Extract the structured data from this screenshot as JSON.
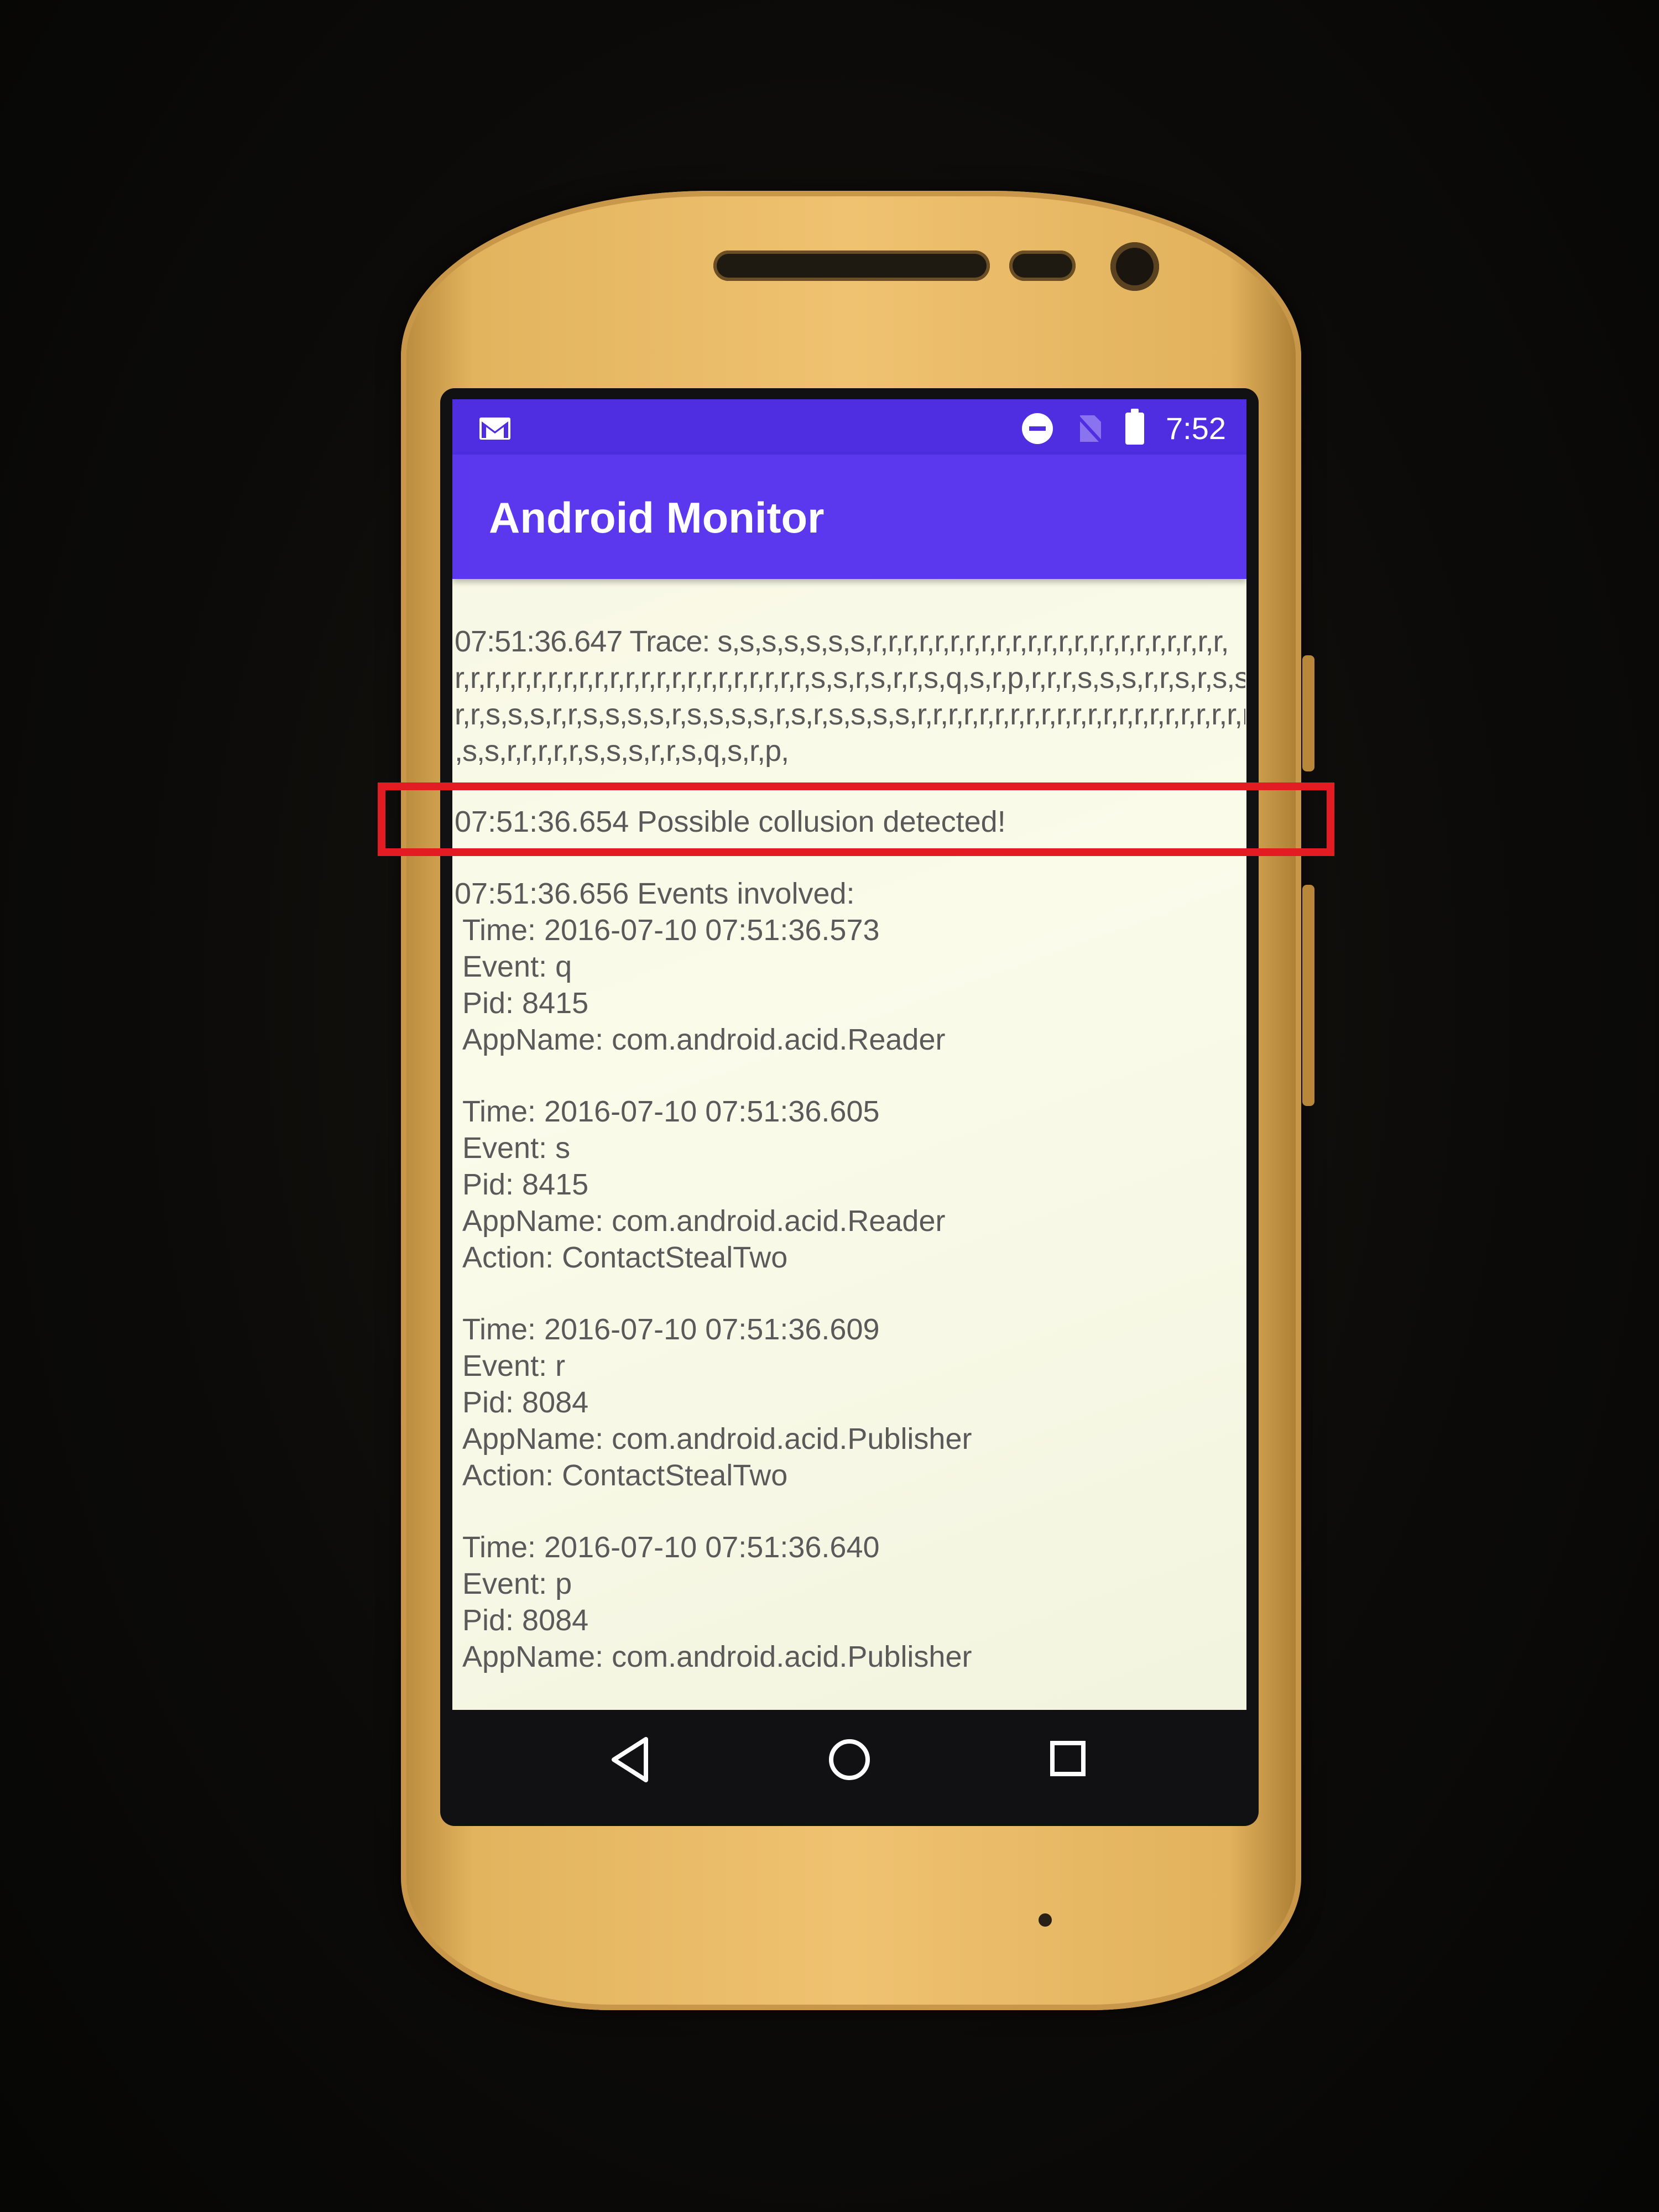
{
  "status_bar": {
    "time": "7:52",
    "icons": [
      "gmail-icon",
      "do-not-disturb-icon",
      "no-sim-icon",
      "battery-icon"
    ]
  },
  "app_bar": {
    "title": "Android Monitor"
  },
  "log": {
    "trace_lines": [
      "07:51:36.647 Trace: s,s,s,s,s,s,s,r,r,r,r,r,r,r,r,r,r,r,r,r,r,r,r,r,r,r,r,r,r,r,",
      "r,r,r,r,r,r,r,r,r,r,r,r,r,r,r,r,r,r,r,r,r,r,r,s,s,r,s,r,r,s,q,s,r,p,r,r,r,s,s,s,r,r,s,r,s,s,s,s,r,",
      "r,r,s,s,s,r,r,s,s,s,s,r,s,s,s,s,r,s,r,s,s,s,s,r,r,r,r,r,r,r,r,r,r,r,r,r,r,r,r,r,r,r,r,r,r,r,r,",
      ",s,s,r,r,r,r,r,s,s,s,r,r,s,q,s,r,p,"
    ],
    "collusion": "07:51:36.654 Possible collusion detected!",
    "events_header": "07:51:36.656 Events involved:",
    "events": [
      {
        "time": "Time: 2016-07-10 07:51:36.573",
        "event": "Event: q",
        "pid": "Pid: 8415",
        "app": "AppName: com.android.acid.Reader"
      },
      {
        "time": "Time: 2016-07-10 07:51:36.605",
        "event": "Event: s",
        "pid": "Pid: 8415",
        "app": "AppName: com.android.acid.Reader",
        "action": "Action: ContactStealTwo"
      },
      {
        "time": "Time: 2016-07-10 07:51:36.609",
        "event": "Event: r",
        "pid": "Pid: 8084",
        "app": "AppName: com.android.acid.Publisher",
        "action": "Action: ContactStealTwo"
      },
      {
        "time": "Time: 2016-07-10 07:51:36.640",
        "event": "Event: p",
        "pid": "Pid: 8084",
        "app": "AppName: com.android.acid.Publisher"
      }
    ]
  },
  "colors": {
    "status_bar": "#4f2de0",
    "app_bar": "#5b37ee",
    "highlight": "#e31b23",
    "phone_body": "#efc271"
  }
}
